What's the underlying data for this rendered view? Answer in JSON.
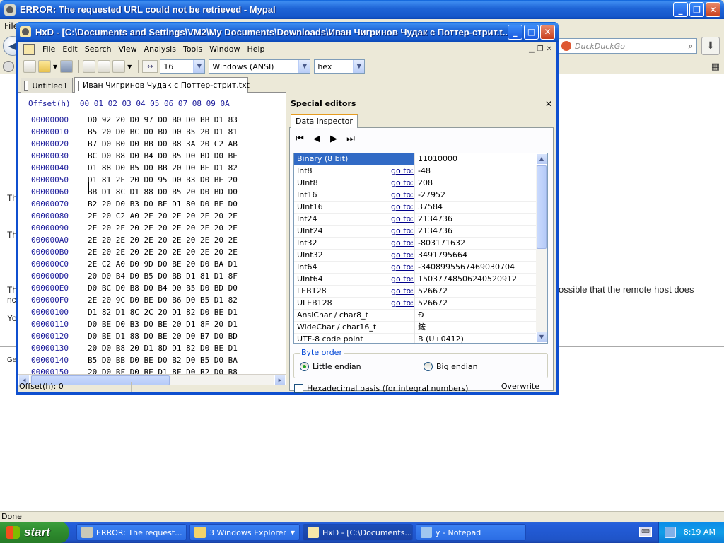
{
  "browser": {
    "title": "ERROR: The requested URL could not be retrieved - Mypal",
    "menu_first": "File",
    "search_placeholder": "DuckDuckGo",
    "error_fragment": "ossible that the remote host does",
    "peek": [
      "Th",
      "Th",
      "Th",
      "nc",
      "Yo",
      "Ge"
    ],
    "status": "Done"
  },
  "hxd": {
    "title": "HxD - [C:\\Documents and Settings\\VM2\\My Documents\\Downloads\\Иван Чигринов Чудак с Поттер-стрит.t...",
    "menu": [
      "File",
      "Edit",
      "Search",
      "View",
      "Analysis",
      "Tools",
      "Window",
      "Help"
    ],
    "toolbar": {
      "bytes_per_row": "16",
      "charset": "Windows (ANSI)",
      "base": "hex"
    },
    "tabs": [
      "Untitled1",
      "Иван Чигринов Чудак с Поттер-стрит.txt"
    ],
    "hex_header": "Offset(h)  00 01 02 03 04 05 06 07 08 09 0A",
    "rows": [
      {
        "off": "00000000",
        "bytes": "D0 92 20 D0 97 D0 B0 D0 BB D1 83"
      },
      {
        "off": "00000010",
        "bytes": "B5 20 D0 BC D0 BD D0 B5 20 D1 81"
      },
      {
        "off": "00000020",
        "bytes": "B7 D0 B0 D0 BB D0 B8 3A 20 C2 AB"
      },
      {
        "off": "00000030",
        "bytes": "BC D0 B8 D0 B4 D0 B5 D0 BD D0 BE"
      },
      {
        "off": "00000040",
        "bytes": "D1 88 D0 B5 D0 BB 20 D0 BE D1 82"
      },
      {
        "off": "00000050",
        "bytes": "D1 81 2E 20 D0 95 D0 B3 D0 BE 20"
      },
      {
        "off": "00000060",
        "bytes": "BB D1 8C D1 88 D0 B5 20 D0 BD D0"
      },
      {
        "off": "00000070",
        "bytes": "B2 20 D0 B3 D0 BE D1 80 D0 BE D0"
      },
      {
        "off": "00000080",
        "bytes": "2E 20 C2 A0 2E 20 2E 20 2E 20 2E"
      },
      {
        "off": "00000090",
        "bytes": "2E 20 2E 20 2E 20 2E 20 2E 20 2E"
      },
      {
        "off": "000000A0",
        "bytes": "2E 20 2E 20 2E 20 2E 20 2E 20 2E"
      },
      {
        "off": "000000B0",
        "bytes": "2E 20 2E 20 2E 20 2E 20 2E 20 2E"
      },
      {
        "off": "000000C0",
        "bytes": "2E C2 A0 D0 9D D0 BE 20 D0 BA D1"
      },
      {
        "off": "000000D0",
        "bytes": "20 D0 B4 D0 B5 D0 BB D1 81 D1 8F"
      },
      {
        "off": "000000E0",
        "bytes": "D0 BC D0 B8 D0 B4 D0 B5 D0 BD D0"
      },
      {
        "off": "000000F0",
        "bytes": "2E 20 9C D0 BE D0 B6 D0 B5 D1 82"
      },
      {
        "off": "00000100",
        "bytes": "D1 82 D1 8C 2C 20 D1 82 D0 BE D1"
      },
      {
        "off": "00000110",
        "bytes": "D0 BE D0 B3 D0 BE 20 D1 8F 20 D1"
      },
      {
        "off": "00000120",
        "bytes": "D0 BE D1 88 D0 BE 20 D0 B7 D0 BD"
      },
      {
        "off": "00000130",
        "bytes": "20 D0 B8 20 D1 8D D1 82 D0 BE D1"
      },
      {
        "off": "00000140",
        "bytes": "B5 D0 BB D0 BE D0 B2 D0 B5 D0 BA"
      },
      {
        "off": "00000150",
        "bytes": "20 D0 BF D0 BE D1 8F D0 B2 D0 B8"
      }
    ],
    "special_editors": "Special editors",
    "data_inspector_tab": "Data inspector",
    "inspector": [
      {
        "name": "Binary (8 bit)",
        "goto": "",
        "value": "11010000"
      },
      {
        "name": "Int8",
        "goto": "go to:",
        "value": "-48"
      },
      {
        "name": "UInt8",
        "goto": "go to:",
        "value": "208"
      },
      {
        "name": "Int16",
        "goto": "go to:",
        "value": "-27952"
      },
      {
        "name": "UInt16",
        "goto": "go to:",
        "value": "37584"
      },
      {
        "name": "Int24",
        "goto": "go to:",
        "value": "2134736"
      },
      {
        "name": "UInt24",
        "goto": "go to:",
        "value": "2134736"
      },
      {
        "name": "Int32",
        "goto": "go to:",
        "value": "-803171632"
      },
      {
        "name": "UInt32",
        "goto": "go to:",
        "value": "3491795664"
      },
      {
        "name": "Int64",
        "goto": "go to:",
        "value": "-3408995567469030704"
      },
      {
        "name": "UInt64",
        "goto": "go to:",
        "value": "15037748506240520912"
      },
      {
        "name": "LEB128",
        "goto": "go to:",
        "value": "526672"
      },
      {
        "name": "ULEB128",
        "goto": "go to:",
        "value": "526672"
      },
      {
        "name": "AnsiChar / char8_t",
        "goto": "",
        "value": "Ð"
      },
      {
        "name": "WideChar / char16_t",
        "goto": "",
        "value": "鋐"
      },
      {
        "name": "UTF-8 code point",
        "goto": "",
        "value": "В (U+0412)"
      }
    ],
    "byte_order_label": "Byte order",
    "little_endian": "Little endian",
    "big_endian": "Big endian",
    "hex_basis": "Hexadecimal basis (for integral numbers)",
    "status_offset": "Offset(h): 0",
    "status_mode": "Overwrite"
  },
  "taskbar": {
    "start": "start",
    "items": [
      "ERROR: The request...",
      "3 Windows Explorer",
      "HxD - [C:\\Documents...",
      "y - Notepad"
    ],
    "clock": "8:19 AM"
  }
}
